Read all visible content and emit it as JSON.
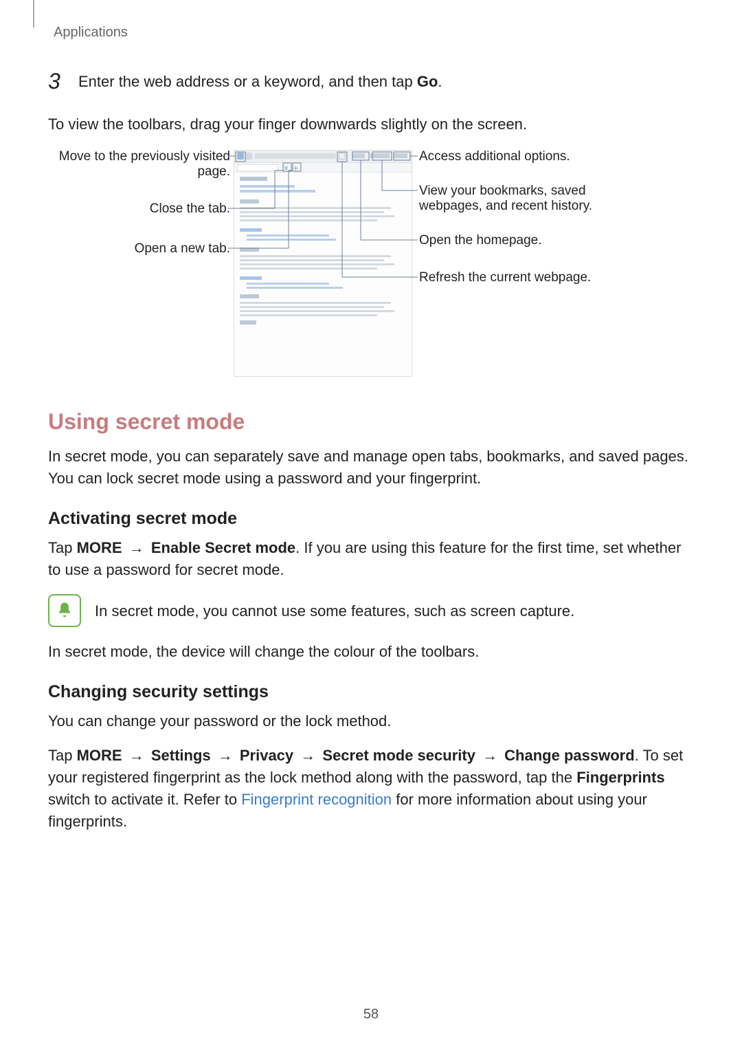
{
  "breadcrumb": "Applications",
  "step": {
    "number": "3",
    "text_before": "Enter the web address or a keyword, and then tap ",
    "bold": "Go",
    "text_after": "."
  },
  "toolbar_para": "To view the toolbars, drag your finger downwards slightly on the screen.",
  "callouts": {
    "left": {
      "prev_page": "Move to the previously visited page.",
      "close_tab": "Close the tab.",
      "new_tab": "Open a new tab."
    },
    "right": {
      "more": "Access additional options.",
      "bookmarks": "View your bookmarks, saved webpages, and recent history.",
      "homepage": "Open the homepage.",
      "refresh": "Refresh the current webpage."
    }
  },
  "secret_mode": {
    "heading": "Using secret mode",
    "intro": "In secret mode, you can separately save and manage open tabs, bookmarks, and saved pages. You can lock secret mode using a password and your fingerprint.",
    "activating": {
      "heading": "Activating secret mode",
      "p1": {
        "t1": "Tap ",
        "b1": "MORE",
        "arr": " → ",
        "b2": "Enable Secret mode",
        "t2": ". If you are using this feature for the first time, set whether to use a password for secret mode."
      },
      "note": "In secret mode, you cannot use some features, such as screen capture.",
      "p2": "In secret mode, the device will change the colour of the toolbars."
    },
    "security": {
      "heading": "Changing security settings",
      "p1": "You can change your password or the lock method.",
      "p2": {
        "t1": "Tap ",
        "b1": "MORE",
        "arr": " → ",
        "b2": "Settings",
        "b3": "Privacy",
        "b4": "Secret mode security",
        "b5": "Change password",
        "t2": ". To set your registered fingerprint as the lock method along with the password, tap the ",
        "b6": "Fingerprints",
        "t3": " switch to activate it. Refer to ",
        "link": "Fingerprint recognition",
        "t4": " for more information about using your fingerprints."
      }
    }
  },
  "page_number": "58"
}
